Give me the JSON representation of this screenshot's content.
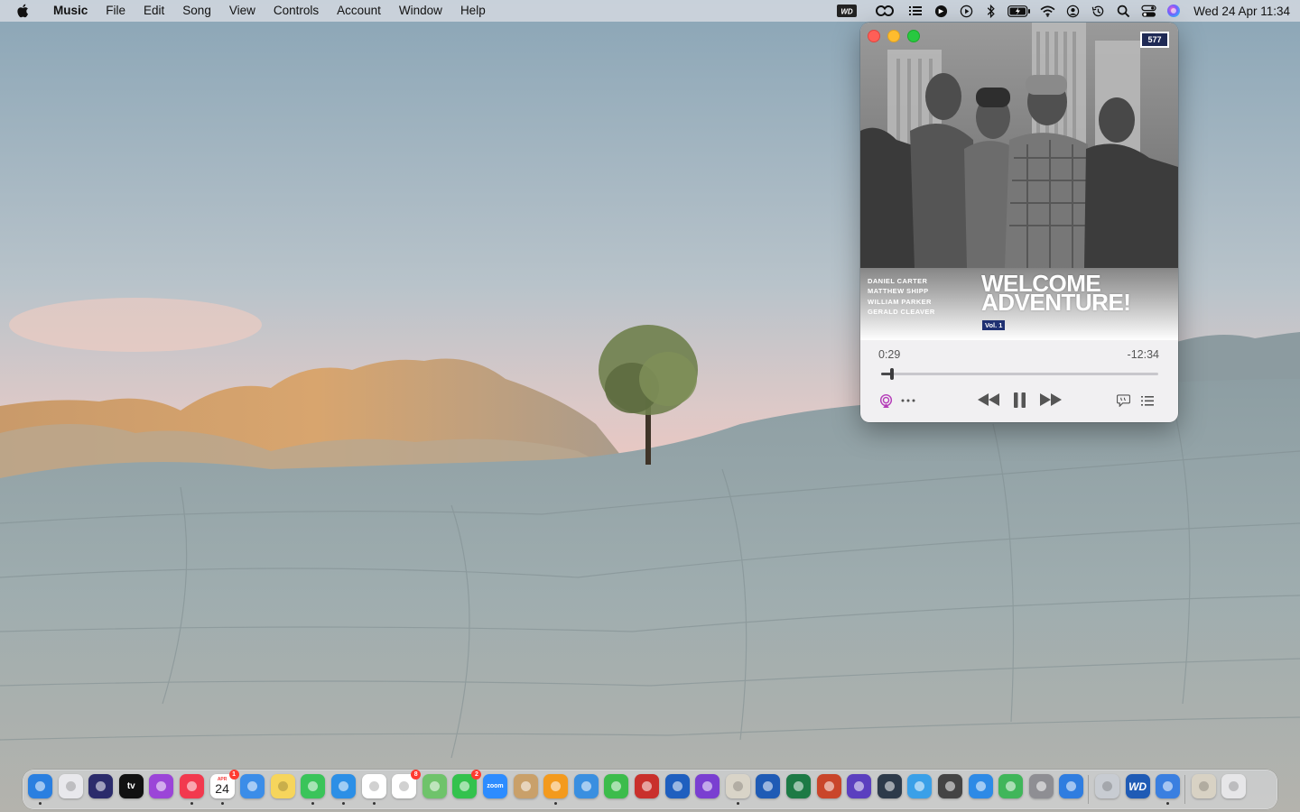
{
  "menubar": {
    "apple_icon": "apple-logo-icon",
    "app_name": "Music",
    "items": [
      "File",
      "Edit",
      "Song",
      "View",
      "Controls",
      "Account",
      "Window",
      "Help"
    ],
    "status_icons": [
      "wd-drive-icon",
      "creative-cloud-icon",
      "list-icon",
      "app-status-icon",
      "play-circle-icon",
      "bluetooth-icon",
      "battery-icon",
      "wifi-icon",
      "user-circle-icon",
      "time-machine-icon",
      "search-icon",
      "control-center-icon",
      "siri-icon"
    ],
    "clock": "Wed 24 Apr  11:34",
    "wd_label": "WD"
  },
  "player": {
    "label_logo": "577",
    "credits": [
      "DANIEL CARTER",
      "MATTHEW SHIPP",
      "WILLIAM PARKER",
      "GERALD CLEAVER"
    ],
    "album_title_line1": "WELCOME",
    "album_title_line2": "ADVENTURE!",
    "album_volume": "Vol. 1",
    "elapsed": "0:29",
    "remaining": "-12:34",
    "progress_fraction": 0.04,
    "buttons": {
      "airplay": "airplay-icon",
      "more": "more-icon",
      "rewind": "rewind-icon",
      "pause": "pause-icon",
      "forward": "fast-forward-icon",
      "lyrics": "lyrics-icon",
      "queue": "queue-icon"
    }
  },
  "dock": {
    "apps": [
      {
        "name": "finder",
        "color": "#2a7fe0",
        "running": true
      },
      {
        "name": "launchpad",
        "color": "#e8e8ec",
        "running": false
      },
      {
        "name": "siri",
        "color": "#2b2b6b",
        "running": false
      },
      {
        "name": "apple-tv",
        "color": "#111111",
        "running": false,
        "label": "tv"
      },
      {
        "name": "podcasts",
        "color": "#9b45d8",
        "running": false
      },
      {
        "name": "music",
        "color": "#f2394e",
        "running": true
      },
      {
        "name": "calendar",
        "color": "#ffffff",
        "running": true,
        "label": "24",
        "month": "APR",
        "badge": "1"
      },
      {
        "name": "mail",
        "color": "#3b8de8",
        "running": false
      },
      {
        "name": "notes",
        "color": "#f6d55c",
        "running": false
      },
      {
        "name": "messages",
        "color": "#3ac45a",
        "running": true
      },
      {
        "name": "safari",
        "color": "#2c8fe6",
        "running": true
      },
      {
        "name": "photos",
        "color": "#ffffff",
        "running": true
      },
      {
        "name": "reminders",
        "color": "#ffffff",
        "running": false,
        "badge": "8"
      },
      {
        "name": "maps",
        "color": "#6fc36b",
        "running": false
      },
      {
        "name": "facetime",
        "color": "#33c24d",
        "running": false,
        "badge": "2"
      },
      {
        "name": "zoom",
        "color": "#2d8cff",
        "running": false,
        "label": "zoom"
      },
      {
        "name": "contacts",
        "color": "#c9a06a",
        "running": false
      },
      {
        "name": "pages",
        "color": "#f39a1e",
        "running": true
      },
      {
        "name": "keynote",
        "color": "#3a8fe0",
        "running": false
      },
      {
        "name": "numbers",
        "color": "#3cbc4c",
        "running": false
      },
      {
        "name": "affinity-publisher",
        "color": "#c9302c",
        "running": false
      },
      {
        "name": "affinity-designer",
        "color": "#1f5fbf",
        "running": false
      },
      {
        "name": "affinity-photo",
        "color": "#7a3fd1",
        "running": false
      },
      {
        "name": "script-editor",
        "color": "#d9d4c8",
        "running": true
      },
      {
        "name": "word",
        "color": "#1f5bb5",
        "running": false
      },
      {
        "name": "excel",
        "color": "#1d7a45",
        "running": false
      },
      {
        "name": "powerpoint",
        "color": "#c9452a",
        "running": false
      },
      {
        "name": "imovie",
        "color": "#5b3fbf",
        "running": false
      },
      {
        "name": "quicktime",
        "color": "#2d3a4a",
        "running": false
      },
      {
        "name": "teamviewer",
        "color": "#3aa0e8",
        "running": false
      },
      {
        "name": "calculator",
        "color": "#444444",
        "running": false
      },
      {
        "name": "app-store",
        "color": "#2d8ae6",
        "running": false
      },
      {
        "name": "find-my",
        "color": "#40b65a",
        "running": false
      },
      {
        "name": "system-settings",
        "color": "#8e8e93",
        "running": false
      },
      {
        "name": "onedrive",
        "color": "#2f7de0",
        "running": false
      },
      {
        "name": "disk-utility",
        "color": "#c8ccd2",
        "running": false
      },
      {
        "name": "wd-discovery",
        "color": "#1f5bb5",
        "running": false,
        "label": "WD"
      },
      {
        "name": "wd-backup",
        "color": "#3a7fe0",
        "running": true
      },
      {
        "name": "preview-folder",
        "color": "#d8d2c4",
        "running": false
      },
      {
        "name": "trash",
        "color": "#e6e6e8",
        "running": false
      }
    ]
  }
}
